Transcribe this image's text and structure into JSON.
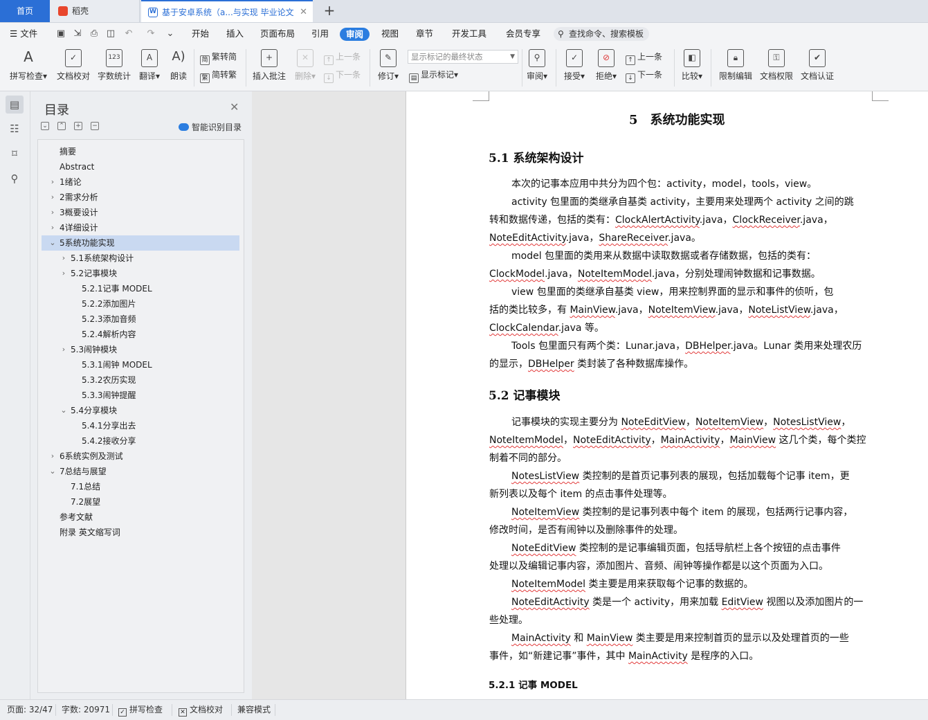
{
  "tabs": [
    {
      "label": "首页"
    },
    {
      "label": "稻壳"
    },
    {
      "label": "基于安卓系统（a...与实现 毕业论文"
    }
  ],
  "menu": {
    "file": "文件",
    "items": [
      "开始",
      "插入",
      "页面布局",
      "引用",
      "审阅",
      "视图",
      "章节",
      "开发工具",
      "会员专享"
    ],
    "active_index": 4,
    "search": "查找命令、搜索模板"
  },
  "ribbon": {
    "spell": "拼写检查",
    "proof": "文档校对",
    "wordcount": "字数统计",
    "translate": "翻译",
    "read": "朗读",
    "trad": "繁转简",
    "simp": "简转繁",
    "insert_comment": "插入批注",
    "delete": "删除",
    "prev_comment": "上一条",
    "next_comment": "下一条",
    "revise": "修订",
    "markstate": "显示标记的最终状态",
    "showmark": "显示标记",
    "review": "审阅",
    "accept": "接受",
    "reject": "拒绝",
    "prev": "上一条",
    "next": "下一条",
    "compare": "比较",
    "restrict": "限制编辑",
    "rights": "文档权限",
    "cert": "文档认证"
  },
  "toc": {
    "title": "目录",
    "smart": "智能识别目录",
    "items": [
      {
        "label": "摘要",
        "level": 0,
        "caret": ""
      },
      {
        "label": "Abstract",
        "level": 0,
        "caret": ""
      },
      {
        "label": "1绪论",
        "level": 0,
        "caret": "›"
      },
      {
        "label": "2需求分析",
        "level": 0,
        "caret": "›"
      },
      {
        "label": "3概要设计",
        "level": 0,
        "caret": "›"
      },
      {
        "label": "4详细设计",
        "level": 0,
        "caret": "›"
      },
      {
        "label": "5系统功能实现",
        "level": 0,
        "caret": "⌄"
      },
      {
        "label": "5.1系统架构设计",
        "level": 1,
        "caret": "›"
      },
      {
        "label": "5.2记事模块",
        "level": 1,
        "caret": "›"
      },
      {
        "label": "5.2.1记事 MODEL",
        "level": 2,
        "caret": ""
      },
      {
        "label": "5.2.2添加图片",
        "level": 2,
        "caret": ""
      },
      {
        "label": "5.2.3添加音频",
        "level": 2,
        "caret": ""
      },
      {
        "label": "5.2.4解析内容",
        "level": 2,
        "caret": ""
      },
      {
        "label": "5.3闹钟模块",
        "level": 1,
        "caret": "›"
      },
      {
        "label": "5.3.1闹钟 MODEL",
        "level": 2,
        "caret": ""
      },
      {
        "label": "5.3.2农历实现",
        "level": 2,
        "caret": ""
      },
      {
        "label": "5.3.3闹钟提醒",
        "level": 2,
        "caret": ""
      },
      {
        "label": "5.4分享模块",
        "level": 1,
        "caret": "⌄"
      },
      {
        "label": "5.4.1分享出去",
        "level": 2,
        "caret": ""
      },
      {
        "label": "5.4.2接收分享",
        "level": 2,
        "caret": ""
      },
      {
        "label": "6系统实例及测试",
        "level": 0,
        "caret": "›"
      },
      {
        "label": "7总结与展望",
        "level": 0,
        "caret": "⌄"
      },
      {
        "label": "7.1总结",
        "level": 1,
        "caret": ""
      },
      {
        "label": "7.2展望",
        "level": 1,
        "caret": ""
      },
      {
        "label": "参考文献",
        "level": 0,
        "caret": ""
      },
      {
        "label": "附录 英文缩写词",
        "level": 0,
        "caret": ""
      }
    ],
    "selected_index": 6
  },
  "document": {
    "chapter": "5　系统功能实现",
    "s51": "5.1 系统架构设计",
    "s52": "5.2 记事模块",
    "s521": "5.2.1  记事 MODEL",
    "lines": [
      [
        {
          "t": "本次的记事本应用中共分为四个包：activity，model，tools，view。"
        }
      ],
      [
        {
          "t": "activity 包里面的类继承自基类 activity，主要用来处理两个 activity 之间的跳"
        }
      ],
      [
        {
          "t": "转和数据传递，包括的类有："
        },
        {
          "t": "ClockAlertActivity",
          "sq": true
        },
        {
          "t": ".java，"
        },
        {
          "t": "ClockReceiver",
          "sq": true
        },
        {
          "t": ".java，"
        }
      ],
      [
        {
          "t": "NoteEditActivity",
          "sq": true
        },
        {
          "t": ".java，"
        },
        {
          "t": "ShareReceiver",
          "sq": true
        },
        {
          "t": ".java。"
        }
      ],
      [
        {
          "t": "model 包里面的类用来从数据中读取数据或者存储数据，包括的类有："
        }
      ],
      [
        {
          "t": "ClockModel",
          "sq": true
        },
        {
          "t": ".java，"
        },
        {
          "t": "NoteItemModel",
          "sq": true
        },
        {
          "t": ".java，分别处理闹钟数据和记事数据。"
        }
      ],
      [
        {
          "t": "view 包里面的类继承自基类 view，用来控制界面的显示和事件的侦听，包"
        }
      ],
      [
        {
          "t": "括的类比较多，有 "
        },
        {
          "t": "MainView",
          "sq": true
        },
        {
          "t": ".java，"
        },
        {
          "t": "NoteItemView",
          "sq": true
        },
        {
          "t": ".java，"
        },
        {
          "t": "NoteListView",
          "sq": true
        },
        {
          "t": ".java，"
        }
      ],
      [
        {
          "t": "ClockCalendar",
          "sq": true
        },
        {
          "t": ".java 等。"
        }
      ],
      [
        {
          "t": "Tools 包里面只有两个类：Lunar.java，"
        },
        {
          "t": "DBHelper",
          "sq": true
        },
        {
          "t": ".java。Lunar 类用来处理农历"
        }
      ],
      [
        {
          "t": "的显示，"
        },
        {
          "t": "DBHelper",
          "sq": true
        },
        {
          "t": " 类封装了各种数据库操作。"
        }
      ],
      [
        {
          "t": "记事模块的实现主要分为 "
        },
        {
          "t": "NoteEditView",
          "sq": true
        },
        {
          "t": "，"
        },
        {
          "t": "NoteItemView",
          "sq": true
        },
        {
          "t": "，"
        },
        {
          "t": "NotesListView",
          "sq": true
        },
        {
          "t": "，"
        }
      ],
      [
        {
          "t": "NoteItemModel",
          "sq": true
        },
        {
          "t": "，"
        },
        {
          "t": "NoteEditActivity",
          "sq": true
        },
        {
          "t": "，"
        },
        {
          "t": "MainActivity",
          "sq": true
        },
        {
          "t": "，"
        },
        {
          "t": "MainView",
          "sq": true
        },
        {
          "t": " 这几个类，每个类控"
        }
      ],
      [
        {
          "t": "制着不同的部分。"
        }
      ],
      [
        {
          "t": "NotesListView",
          "sq": true
        },
        {
          "t": " 类控制的是首页记事列表的展现，包括加载每个记事 item，更"
        }
      ],
      [
        {
          "t": "新列表以及每个 item 的点击事件处理等。"
        }
      ],
      [
        {
          "t": "NoteItemView",
          "sq": true
        },
        {
          "t": " 类控制的是记事列表中每个 item 的展现，包括两行记事内容，"
        }
      ],
      [
        {
          "t": "修改时间，是否有闹钟以及删除事件的处理。"
        }
      ],
      [
        {
          "t": "NoteEditView",
          "sq": true
        },
        {
          "t": " 类控制的是记事编辑页面，包括导航栏上各个按钮的点击事件"
        }
      ],
      [
        {
          "t": "处理以及编辑记事内容，添加图片、音频、闹钟等操作都是以这个页面为入口。"
        }
      ],
      [
        {
          "t": "NoteItemModel",
          "sq": true
        },
        {
          "t": " 类主要是用来获取每个记事的数据的。"
        }
      ],
      [
        {
          "t": "NoteEditActivity",
          "sq": true
        },
        {
          "t": " 类是一个 activity，用来加载 "
        },
        {
          "t": "EditView",
          "sq": true
        },
        {
          "t": " 视图以及添加图片的一"
        }
      ],
      [
        {
          "t": "些处理。"
        }
      ],
      [
        {
          "t": "MainActivity",
          "sq": true
        },
        {
          "t": " 和 "
        },
        {
          "t": "MainView",
          "sq": true
        },
        {
          "t": " 类主要是用来控制首页的显示以及处理首页的一些"
        }
      ],
      [
        {
          "t": "事件，如“新建记事”事件，其中 "
        },
        {
          "t": "MainActivity",
          "sq": true
        },
        {
          "t": " 是程序的入口。"
        }
      ]
    ]
  },
  "status": {
    "page": "页面: 32/47",
    "words": "字数: 20971",
    "spell": "拼写检查",
    "proof": "文档校对",
    "compat": "兼容模式"
  }
}
